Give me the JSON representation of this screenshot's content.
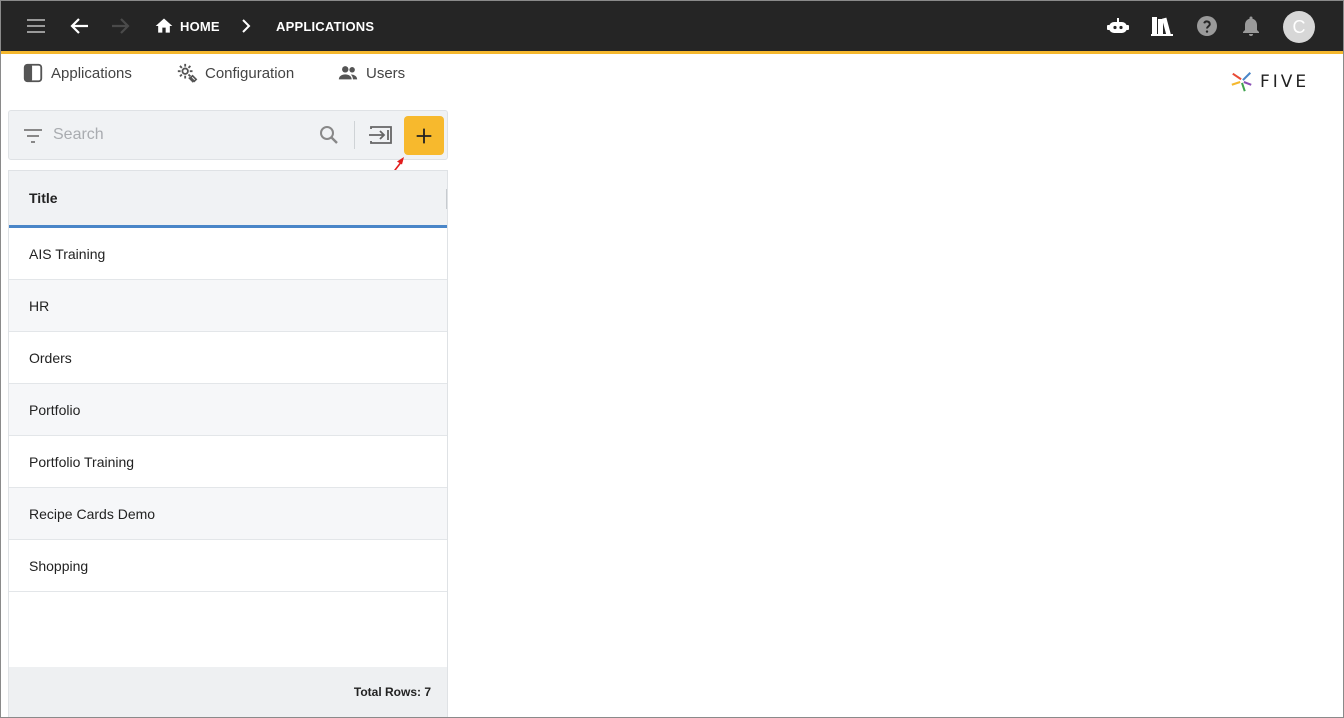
{
  "header": {
    "breadcrumb_home": "HOME",
    "breadcrumb_current": "APPLICATIONS",
    "avatar_initial": "C",
    "icons": [
      "menu-icon",
      "back-icon",
      "forward-icon",
      "home-icon",
      "chevron-right-icon",
      "chatbot-icon",
      "library-icon",
      "help-icon",
      "bell-icon"
    ],
    "accent_color": "#f5b82e"
  },
  "tabs": [
    {
      "label": "Applications",
      "icon": "applications-icon"
    },
    {
      "label": "Configuration",
      "icon": "configuration-icon"
    },
    {
      "label": "Users",
      "icon": "users-icon"
    }
  ],
  "logo": {
    "text": "FIVE"
  },
  "search": {
    "placeholder": "Search",
    "value": ""
  },
  "table": {
    "column_header": "Title",
    "rows": [
      "AIS Training",
      "HR",
      "Orders",
      "Portfolio",
      "Portfolio Training",
      "Recipe Cards Demo",
      "Shopping"
    ],
    "footer": "Total Rows: 7"
  }
}
